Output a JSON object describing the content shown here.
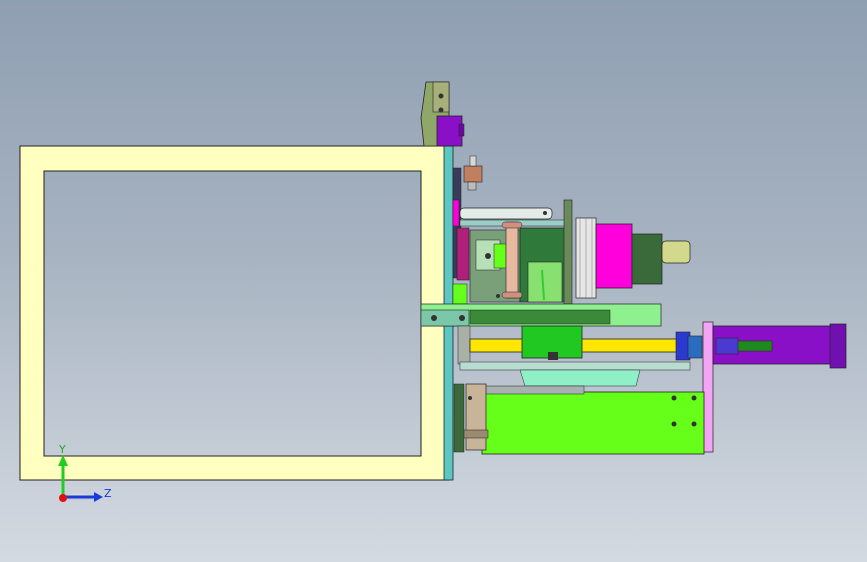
{
  "viewport": {
    "background_top": "#8f9fb2",
    "background_bottom": "#d4dae2"
  },
  "model": {
    "colors": {
      "frame": "#ffffc0",
      "teal_plate": "#5cc6c0",
      "green_block": "#66ff19",
      "dark_green": "#3a8a3a",
      "magenta": "#ff00dd",
      "purple": "#8a10c8",
      "pink_plate": "#f4a4f4",
      "yellow_rod": "#ffe600",
      "olive": "#6e8a3a",
      "light_steel": "#b8c4c8",
      "bronze": "#c08060"
    }
  },
  "triad": {
    "y_label": "Y",
    "z_label": "Z",
    "y_color": "#22cc22",
    "z_color": "#1a3adc",
    "x_color": "#dd1111"
  }
}
